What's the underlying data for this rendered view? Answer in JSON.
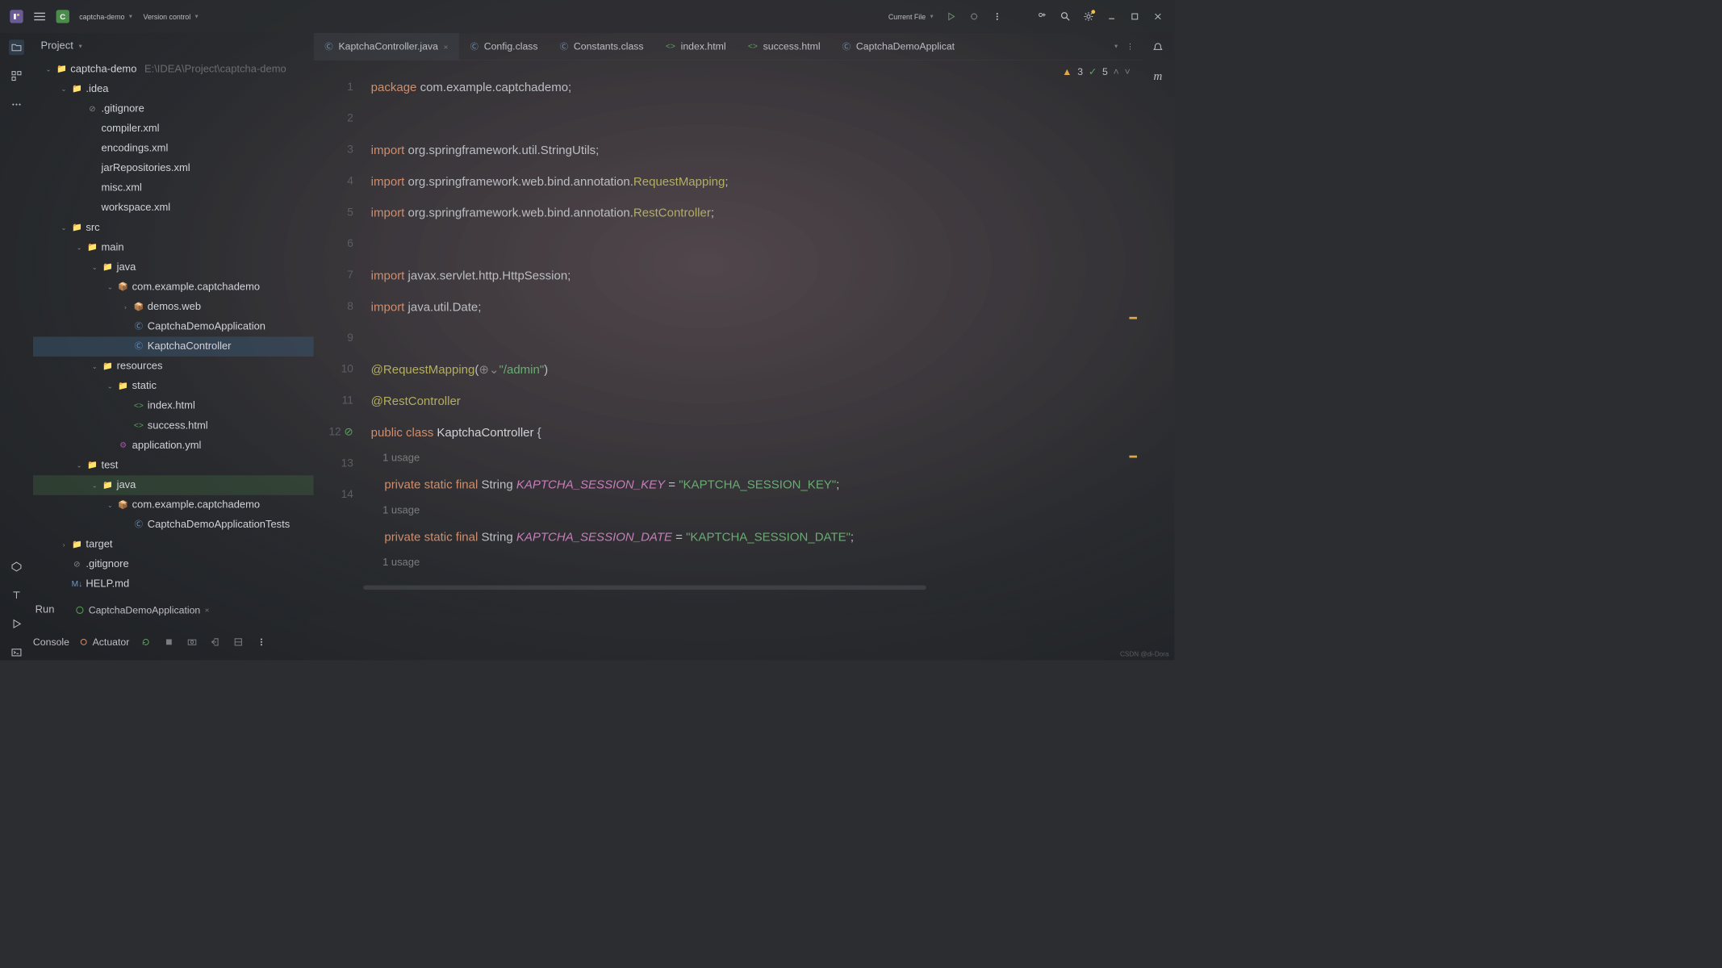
{
  "titlebar": {
    "project_badge": "C",
    "project_name": "captcha-demo",
    "vcs_label": "Version control",
    "run_config": "Current File"
  },
  "sidebar": {
    "title": "Project",
    "tree": [
      {
        "depth": 0,
        "caret": "v",
        "icon": "folder",
        "label": "captcha-demo",
        "hint": "E:\\IDEA\\Project\\captcha-demo"
      },
      {
        "depth": 1,
        "caret": "v",
        "icon": "folder",
        "label": ".idea"
      },
      {
        "depth": 2,
        "caret": "",
        "icon": "ignore",
        "label": ".gitignore"
      },
      {
        "depth": 2,
        "caret": "",
        "icon": "xml",
        "label": "compiler.xml"
      },
      {
        "depth": 2,
        "caret": "",
        "icon": "xml",
        "label": "encodings.xml"
      },
      {
        "depth": 2,
        "caret": "",
        "icon": "xml",
        "label": "jarRepositories.xml"
      },
      {
        "depth": 2,
        "caret": "",
        "icon": "xml",
        "label": "misc.xml"
      },
      {
        "depth": 2,
        "caret": "",
        "icon": "xml",
        "label": "workspace.xml"
      },
      {
        "depth": 1,
        "caret": "v",
        "icon": "folder",
        "label": "src"
      },
      {
        "depth": 2,
        "caret": "v",
        "icon": "folder-blue",
        "label": "main"
      },
      {
        "depth": 3,
        "caret": "v",
        "icon": "folder-blue",
        "label": "java"
      },
      {
        "depth": 4,
        "caret": "v",
        "icon": "package",
        "label": "com.example.captchademo"
      },
      {
        "depth": 5,
        "caret": ">",
        "icon": "package",
        "label": "demos.web"
      },
      {
        "depth": 5,
        "caret": "",
        "icon": "java-c",
        "label": "CaptchaDemoApplication"
      },
      {
        "depth": 5,
        "caret": "",
        "icon": "java-c",
        "label": "KaptchaController",
        "selected": true
      },
      {
        "depth": 3,
        "caret": "v",
        "icon": "folder-res",
        "label": "resources"
      },
      {
        "depth": 4,
        "caret": "v",
        "icon": "folder",
        "label": "static"
      },
      {
        "depth": 5,
        "caret": "",
        "icon": "html",
        "label": "index.html"
      },
      {
        "depth": 5,
        "caret": "",
        "icon": "html",
        "label": "success.html"
      },
      {
        "depth": 4,
        "caret": "",
        "icon": "yml",
        "label": "application.yml"
      },
      {
        "depth": 2,
        "caret": "v",
        "icon": "folder",
        "label": "test"
      },
      {
        "depth": 3,
        "caret": "v",
        "icon": "folder-blue",
        "label": "java",
        "highlighted": true
      },
      {
        "depth": 4,
        "caret": "v",
        "icon": "package",
        "label": "com.example.captchademo"
      },
      {
        "depth": 5,
        "caret": "",
        "icon": "java-c",
        "label": "CaptchaDemoApplicationTests"
      },
      {
        "depth": 1,
        "caret": ">",
        "icon": "folder",
        "label": "target"
      },
      {
        "depth": 1,
        "caret": "",
        "icon": "ignore",
        "label": ".gitignore"
      },
      {
        "depth": 1,
        "caret": "",
        "icon": "md",
        "label": "HELP.md",
        "cutoff": true
      }
    ]
  },
  "tabs": [
    {
      "icon": "java-c",
      "label": "KaptchaController.java",
      "active": true,
      "closable": true
    },
    {
      "icon": "java-c",
      "label": "Config.class"
    },
    {
      "icon": "java-c",
      "label": "Constants.class"
    },
    {
      "icon": "html",
      "label": "index.html"
    },
    {
      "icon": "html",
      "label": "success.html"
    },
    {
      "icon": "java-c",
      "label": "CaptchaDemoApplicat"
    }
  ],
  "editor_status": {
    "warnings": "3",
    "passes": "5"
  },
  "code": {
    "lines": [
      {
        "n": "1",
        "kind": "text",
        "html": "<span class='kw'>package</span> com.example.captchademo;"
      },
      {
        "n": "2",
        "kind": "blank"
      },
      {
        "n": "3",
        "kind": "text",
        "html": "<span class='kw'>import</span> org.springframework.util.StringUtils;"
      },
      {
        "n": "4",
        "kind": "text",
        "html": "<span class='kw'>import</span> org.springframework.web.bind.annotation.<span class='ann'>RequestMapping</span>;"
      },
      {
        "n": "5",
        "kind": "text",
        "html": "<span class='kw'>import</span> org.springframework.web.bind.annotation.<span class='ann'>RestController</span>;"
      },
      {
        "n": "6",
        "kind": "blank"
      },
      {
        "n": "7",
        "kind": "text",
        "html": "<span class='kw'>import</span> javax.servlet.http.HttpSession;"
      },
      {
        "n": "8",
        "kind": "text",
        "html": "<span class='kw'>import</span> java.util.Date;"
      },
      {
        "n": "9",
        "kind": "blank"
      },
      {
        "n": "10",
        "kind": "text",
        "html": "<span class='ann'>@RequestMapping</span>(<span style='color:#888'>⊕⌄</span><span class='str'>\"/admin\"</span>)"
      },
      {
        "n": "11",
        "kind": "text",
        "html": "<span class='ann'>@RestController</span>"
      },
      {
        "n": "12",
        "kind": "text",
        "html": "<span class='kw'>public</span> <span class='kw'>class</span> <span class='cls'>KaptchaController</span> {",
        "gutter_icon": true
      },
      {
        "n": "",
        "kind": "hint",
        "html": "    1 usage"
      },
      {
        "n": "13",
        "kind": "text",
        "html": "    <span class='kw'>private</span> <span class='kw'>static</span> <span class='kw'>final</span> String <span class='fld'>KAPTCHA_SESSION_KEY</span> = <span class='str'>\"KAPTCHA_SESSION_KEY\"</span>;"
      },
      {
        "n": "",
        "kind": "hint",
        "html": "    1 usage"
      },
      {
        "n": "14",
        "kind": "text",
        "html": "    <span class='kw'>private</span> <span class='kw'>static</span> <span class='kw'>final</span> String <span class='fld'>KAPTCHA_SESSION_DATE</span> = <span class='str'>\"KAPTCHA_SESSION_DATE\"</span>;"
      },
      {
        "n": "",
        "kind": "hint",
        "html": "    1 usage"
      }
    ]
  },
  "run_panel": {
    "title": "Run",
    "tab_label": "CaptchaDemoApplication"
  },
  "console_panel": {
    "console": "Console",
    "actuator": "Actuator"
  },
  "watermark": "CSDN @di-Dora",
  "icon_colors": {
    "accent_green": "#5aa25a",
    "accent_orange": "#cf8e6d",
    "accent_purple": "#c77dbb"
  }
}
